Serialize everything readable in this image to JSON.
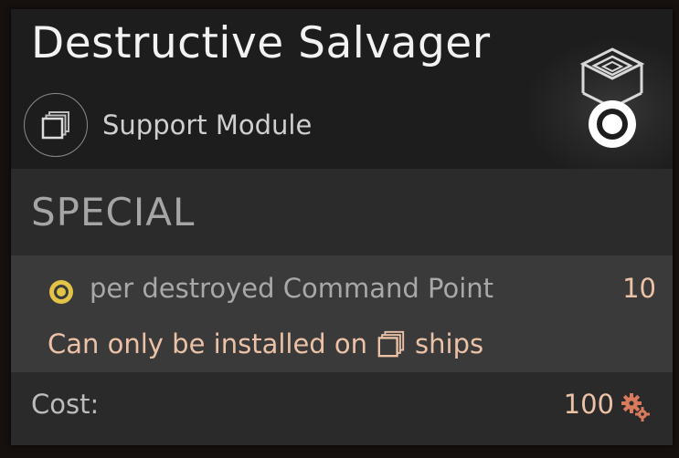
{
  "tooltip": {
    "title": "Destructive Salvager",
    "subtitle": "Support Module",
    "type_icon": "stacked-squares-icon",
    "module_icon": "salvager-module-icon"
  },
  "special": {
    "header": "SPECIAL",
    "effects": [
      {
        "icon": "resource-coin-icon",
        "text": "per destroyed Command Point",
        "value": "10"
      }
    ],
    "restriction_prefix": "Can only be installed on",
    "restriction_icon": "stacked-squares-icon",
    "restriction_suffix": "ships"
  },
  "cost": {
    "label": "Cost:",
    "value": "100",
    "icon": "gears-icon"
  },
  "colors": {
    "accent_text": "#ecc2a6",
    "coin": "#e3c248",
    "gears": "#d87a5c"
  }
}
